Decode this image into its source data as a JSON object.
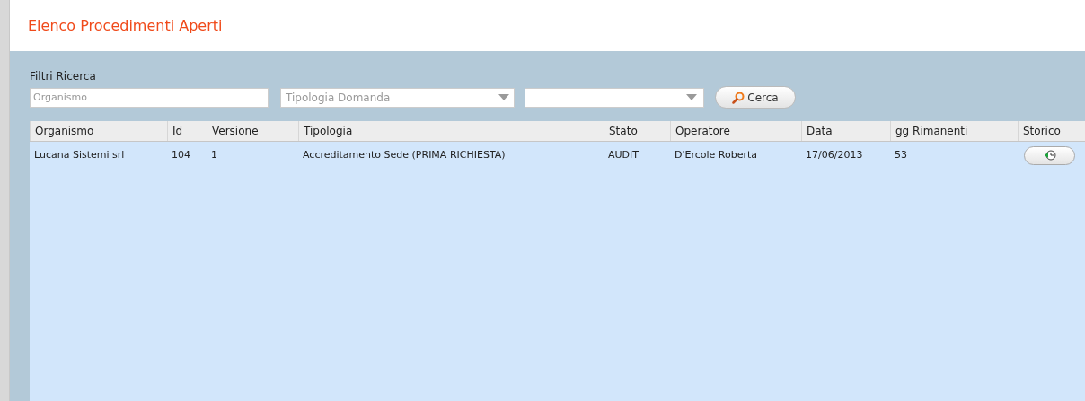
{
  "page": {
    "title": "Elenco Procedimenti Aperti"
  },
  "filters": {
    "label": "Filtri Ricerca",
    "organismo": {
      "placeholder": "Organismo"
    },
    "tipologia": {
      "placeholder": "Tipologia Domanda"
    },
    "search_button": "Cerca"
  },
  "table": {
    "columns": [
      "Organismo",
      "Id",
      "Versione",
      "Tipologia",
      "Stato",
      "Operatore",
      "Data",
      "gg Rimanenti",
      "Storico"
    ],
    "rows": [
      {
        "cells": [
          "Lucana Sistemi srl",
          "104",
          "1",
          "Accreditamento Sede (PRIMA RICHIESTA)",
          "AUDIT",
          "D'Ercole Roberta",
          "17/06/2013",
          "53"
        ]
      }
    ]
  }
}
